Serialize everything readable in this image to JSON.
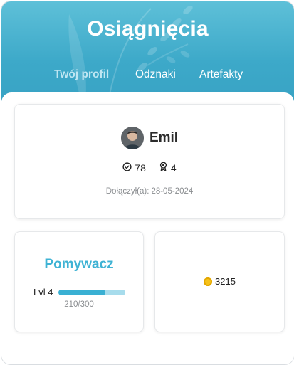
{
  "header": {
    "title": "Osiągnięcia",
    "tabs": [
      {
        "label": "Twój profil",
        "active": true
      },
      {
        "label": "Odznaki",
        "active": false
      },
      {
        "label": "Artefakty",
        "active": false
      }
    ],
    "colors": {
      "primary": "#3da9c9",
      "active_tab": "#bfe6f2"
    }
  },
  "profile": {
    "name": "Emil",
    "avatar_icon": "user-avatar",
    "completed_count": "78",
    "completed_icon": "check-circle-icon",
    "badges_count": "4",
    "badges_icon": "award-icon",
    "joined_label": "Dołączył(a):",
    "joined_date": "28-05-2024"
  },
  "level": {
    "title": "Pomywacz",
    "level_label": "Lvl 4",
    "xp_current": 210,
    "xp_max": 300,
    "xp_text": "210/300",
    "progress_fraction": 0.7,
    "colors": {
      "fill": "#3ab0d3",
      "track": "#a7dcec"
    }
  },
  "coins": {
    "amount": "3215",
    "icon": "coin-icon"
  }
}
